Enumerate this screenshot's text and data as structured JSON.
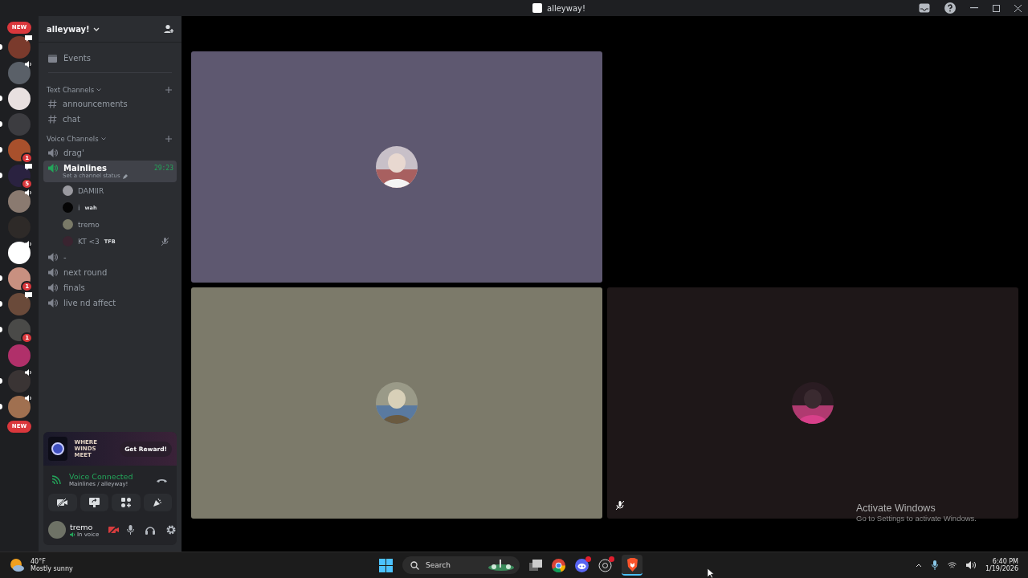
{
  "window": {
    "title": "alleyway!"
  },
  "servers": {
    "new_top": "NEW",
    "new_bottom": "NEW",
    "items": [
      {
        "unread": true,
        "voice": false,
        "chat": true
      },
      {
        "unread": false,
        "voice": true,
        "chat": false
      },
      {
        "unread": true,
        "voice": false,
        "chat": false
      },
      {
        "unread": true,
        "voice": false,
        "chat": false
      },
      {
        "unread": true,
        "badge": "1",
        "voice": false,
        "chat": false
      },
      {
        "unread": true,
        "badge": "5",
        "voice": false,
        "chat": true
      },
      {
        "unread": false,
        "voice": true,
        "chat": false
      },
      {
        "unread": false,
        "voice": false,
        "chat": false
      },
      {
        "unread": false,
        "voice": true,
        "chat": false
      },
      {
        "unread": true,
        "badge": "1",
        "voice": false,
        "chat": false
      },
      {
        "unread": true,
        "voice": false,
        "chat": true
      },
      {
        "unread": true,
        "badge": "1",
        "voice": false,
        "chat": false
      },
      {
        "unread": false,
        "voice": false,
        "chat": false
      },
      {
        "unread": true,
        "voice": true,
        "chat": false
      },
      {
        "unread": true,
        "voice": true,
        "chat": false
      }
    ]
  },
  "sidebar": {
    "server_name": "alleyway!",
    "events": "Events",
    "categories": [
      {
        "name": "Text Channels",
        "channels": [
          {
            "kind": "text",
            "name": "announcements",
            "selected": false
          },
          {
            "kind": "text",
            "name": "chat",
            "selected": false
          }
        ]
      },
      {
        "name": "Voice Channels",
        "channels": [
          {
            "kind": "voice",
            "name": "drag'",
            "selected": false
          },
          {
            "kind": "voice",
            "name": "Mainlines",
            "selected": true,
            "timer": "29:23",
            "status": "Set a channel status",
            "members": [
              {
                "name": "DAMIIR",
                "muted": false
              },
              {
                "name": "i",
                "tag": "wah",
                "muted": false
              },
              {
                "name": "tremo",
                "muted": false
              },
              {
                "name": "KT <3",
                "tag": "TFB",
                "muted": true
              }
            ]
          },
          {
            "kind": "voice",
            "name": "-",
            "selected": false
          },
          {
            "kind": "voice",
            "name": "next round",
            "selected": false
          },
          {
            "kind": "voice",
            "name": "finals",
            "selected": false
          },
          {
            "kind": "voice",
            "name": "live nd affect",
            "selected": false
          }
        ]
      }
    ]
  },
  "promo": {
    "logo": "WHERE WINDS MEET",
    "button": "Get Reward!"
  },
  "voice": {
    "status": "Voice Connected",
    "location": "Mainlines / alleyway!"
  },
  "user": {
    "name": "tremo",
    "status": "In voice",
    "camera_off": true
  },
  "tiles": [
    {
      "kind": "participant",
      "color": "#5e5870",
      "muted": false
    },
    {
      "kind": "empty"
    },
    {
      "kind": "participant",
      "color": "#7c7a6a",
      "muted": false
    },
    {
      "kind": "participant",
      "color": "#1e1718",
      "muted": true
    }
  ],
  "activation": {
    "title": "Activate Windows",
    "hint": "Go to Settings to activate Windows."
  },
  "taskbar": {
    "temperature": "40°F",
    "weather": "Mostly sunny",
    "search": "Search",
    "time": "6:40 PM",
    "date": "1/19/2026"
  }
}
